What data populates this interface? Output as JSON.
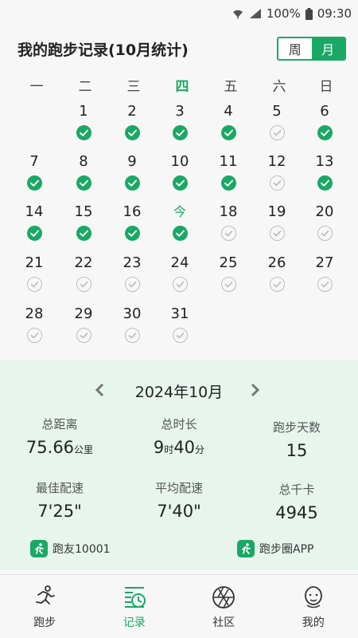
{
  "status_bar": {
    "battery": "100%",
    "time": "09:30"
  },
  "header": {
    "title": "我的跑步记录(10月统计)",
    "toggle": [
      {
        "label": "周",
        "active": false
      },
      {
        "label": "月",
        "active": true
      }
    ]
  },
  "weekdays": [
    "一",
    "二",
    "三",
    "四",
    "五",
    "六",
    "日"
  ],
  "today_weekday_index": 3,
  "calendar": [
    {
      "label": "1",
      "done": true
    },
    {
      "label": "2",
      "done": true
    },
    {
      "label": "3",
      "done": true
    },
    {
      "label": "4",
      "done": true
    },
    {
      "label": "5",
      "done": false
    },
    {
      "label": "6",
      "done": true
    },
    {
      "label": "7",
      "done": true
    },
    {
      "label": "8",
      "done": true
    },
    {
      "label": "9",
      "done": true
    },
    {
      "label": "10",
      "done": true
    },
    {
      "label": "11",
      "done": true
    },
    {
      "label": "12",
      "done": false
    },
    {
      "label": "13",
      "done": true
    },
    {
      "label": "14",
      "done": true
    },
    {
      "label": "15",
      "done": true
    },
    {
      "label": "16",
      "done": true
    },
    {
      "label": "今",
      "done": true,
      "today": true
    },
    {
      "label": "18",
      "done": false
    },
    {
      "label": "19",
      "done": false
    },
    {
      "label": "20",
      "done": false
    },
    {
      "label": "21",
      "done": false
    },
    {
      "label": "22",
      "done": false
    },
    {
      "label": "23",
      "done": false
    },
    {
      "label": "24",
      "done": false
    },
    {
      "label": "25",
      "done": false
    },
    {
      "label": "26",
      "done": false
    },
    {
      "label": "27",
      "done": false
    },
    {
      "label": "28",
      "done": false
    },
    {
      "label": "29",
      "done": false
    },
    {
      "label": "30",
      "done": false
    },
    {
      "label": "31",
      "done": false
    }
  ],
  "calendar_first_day_offset": 1,
  "summary": {
    "month": "2024年10月",
    "stats": {
      "distance": {
        "label": "总距离",
        "value": "75.66",
        "unit": "公里"
      },
      "duration": {
        "label": "总时长",
        "hours": "9",
        "hours_unit": "时",
        "minutes": "40",
        "minutes_unit": "分"
      },
      "days": {
        "label": "跑步天数",
        "value": "15"
      },
      "best_pace": {
        "label": "最佳配速",
        "value": "7'25\""
      },
      "avg_pace": {
        "label": "平均配速",
        "value": "7'40\""
      },
      "calories": {
        "label": "总千卡",
        "value": "4945"
      }
    },
    "user": "跑友10001",
    "app": "跑步圈APP"
  },
  "bottom_nav": [
    {
      "label": "跑步",
      "icon": "runner-icon",
      "active": false
    },
    {
      "label": "记录",
      "icon": "record-calendar-icon",
      "active": true
    },
    {
      "label": "社区",
      "icon": "community-aperture-icon",
      "active": false
    },
    {
      "label": "我的",
      "icon": "profile-face-icon",
      "active": false
    }
  ],
  "colors": {
    "accent": "#1aa865",
    "summary_bg": "#e7f5ed",
    "inactive_mark": "#bdbdbd"
  }
}
